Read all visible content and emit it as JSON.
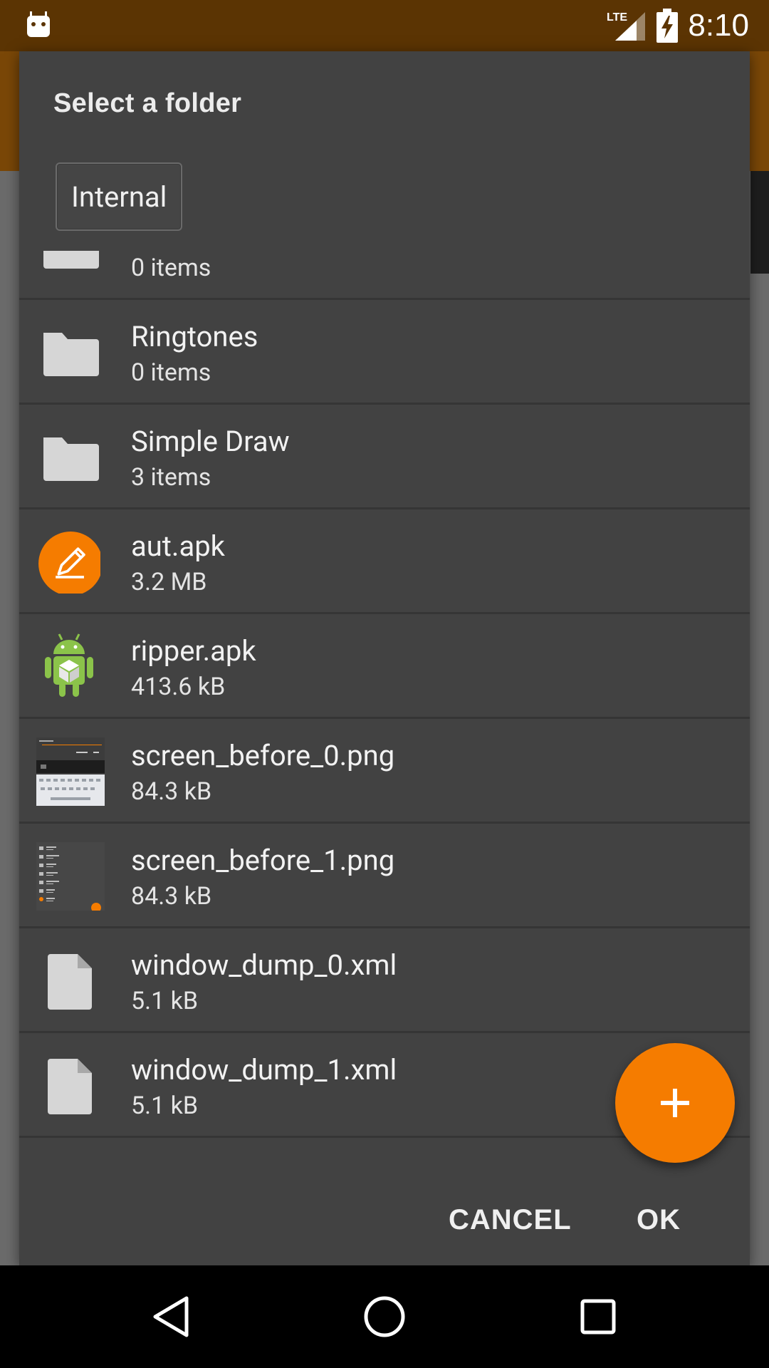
{
  "status_bar": {
    "time": "8:10",
    "network": "LTE",
    "icons": [
      "android-debug-icon",
      "lte-signal-icon",
      "battery-charging-icon"
    ]
  },
  "dialog": {
    "title": "Select a folder",
    "storage_selector": "Internal",
    "items": [
      {
        "name": "",
        "meta": "0 items",
        "icon": "folder-icon"
      },
      {
        "name": "Ringtones",
        "meta": "0 items",
        "icon": "folder-icon"
      },
      {
        "name": "Simple Draw",
        "meta": "3 items",
        "icon": "folder-icon"
      },
      {
        "name": "aut.apk",
        "meta": "3.2 MB",
        "icon": "pencil-app-icon"
      },
      {
        "name": "ripper.apk",
        "meta": "413.6 kB",
        "icon": "android-app-icon"
      },
      {
        "name": "screen_before_0.png",
        "meta": "84.3 kB",
        "icon": "image-thumbnail-icon"
      },
      {
        "name": "screen_before_1.png",
        "meta": "84.3 kB",
        "icon": "image-thumbnail-icon"
      },
      {
        "name": "window_dump_0.xml",
        "meta": "5.1 kB",
        "icon": "file-icon"
      },
      {
        "name": "window_dump_1.xml",
        "meta": "5.1 kB",
        "icon": "file-icon"
      }
    ],
    "actions": {
      "cancel": "CANCEL",
      "ok": "OK"
    }
  },
  "fab": {
    "icon": "plus-icon"
  },
  "colors": {
    "accent": "#f57c00",
    "status_bar": "#5b3403",
    "dialog_bg": "#424242"
  }
}
